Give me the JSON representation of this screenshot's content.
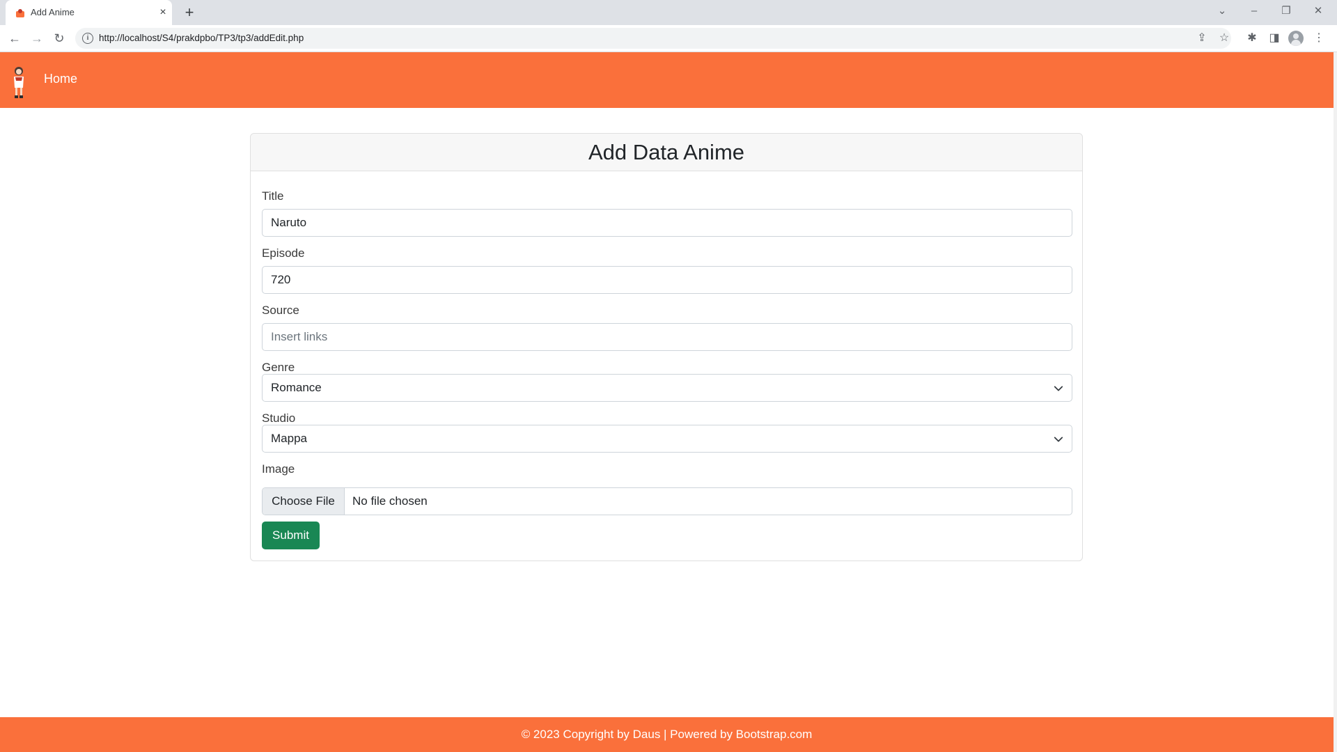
{
  "browser": {
    "tab_title": "Add Anime",
    "tab_close_icon": "×",
    "new_tab_icon": "+",
    "url": "http://localhost/S4/prakdpbo/TP3/tp3/addEdit.php",
    "window_controls": {
      "tab_search": "⌄",
      "minimize": "–",
      "restore": "❐",
      "close": "✕"
    },
    "toolbar_icons": {
      "back": "←",
      "forward": "→",
      "reload": "↻",
      "share": "⇪",
      "bookmark": "☆",
      "extensions": "✱",
      "side_panel": "◨",
      "menu": "⋮"
    }
  },
  "navbar": {
    "home_label": "Home",
    "background": "#fa703b"
  },
  "form": {
    "heading": "Add Data Anime",
    "title_label": "Title",
    "title_value": "Naruto",
    "episode_label": "Episode",
    "episode_value": "720",
    "source_label": "Source",
    "source_placeholder": "Insert links",
    "genre_label": "Genre",
    "genre_selected": "Romance",
    "studio_label": "Studio",
    "studio_selected": "Mappa",
    "image_label": "Image",
    "file_button_label": "Choose File",
    "file_status": "No file chosen",
    "submit_label": "Submit",
    "submit_color": "#198754"
  },
  "footer": {
    "text": "© 2023 Copyright by Daus  |  Powered by Bootstrap.com"
  }
}
